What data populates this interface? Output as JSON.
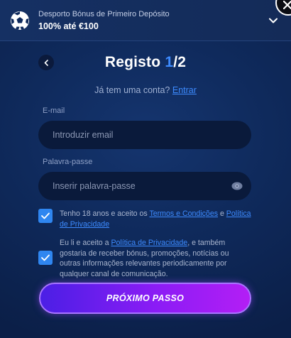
{
  "bonus": {
    "subtitle": "Desporto Bónus de Primeiro Depósito",
    "title": "100% até €100"
  },
  "header": {
    "title_main": "Registo ",
    "title_current": "1",
    "title_total": "/2"
  },
  "login": {
    "prompt": "Já tem uma conta?",
    "link": "Entrar"
  },
  "form": {
    "email_label": "E-mail",
    "email_placeholder": "Introduzir email",
    "password_label": "Palavra-passe",
    "password_placeholder": "Inserir palavra-passe"
  },
  "consent1": {
    "checked": true,
    "text_before": "Tenho 18 anos e aceito os ",
    "link_terms": "Termos e Condições",
    "text_mid": " e ",
    "link_privacy": "Política de Privacidade"
  },
  "consent2": {
    "checked": true,
    "text_before": "Eu li e aceito a ",
    "link_privacy": "Política de Privacidade",
    "text_after": ", e também gostaria de receber bónus, promoções, notícias ou outras informações relevantes periodicamente por qualquer canal de comunicação."
  },
  "cta": {
    "label": "PRÓXIMO PASSO"
  },
  "icons": {
    "soccer_ball": "soccer-ball-icon",
    "chevron": "chevron-down-icon",
    "back": "chevron-left-icon",
    "close": "close-icon",
    "eye": "eye-icon",
    "check": "checkmark-icon"
  },
  "colors": {
    "accent_blue": "#3d8bff",
    "checkbox": "#2f86f0",
    "cta_start": "#4b1fe5",
    "cta_end": "#b31ef5"
  }
}
